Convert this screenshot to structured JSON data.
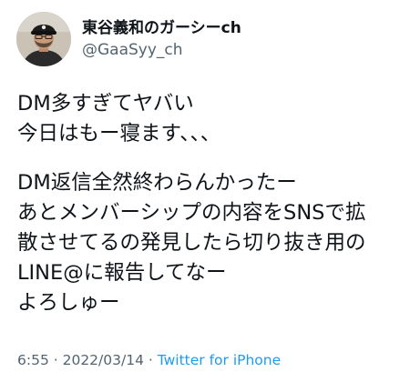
{
  "user": {
    "display_name": "東谷義和のガーシーch",
    "handle": "@GaaSyy_ch"
  },
  "tweet": {
    "paragraph1": [
      "DM多すぎてヤバい",
      "今日はもー寝ます、、、"
    ],
    "paragraph2": [
      "DM返信全然終わらんかったー",
      "あとメンバーシップの内容をSNSで拡",
      "散させてるの発見したら切り抜き用の",
      "LINE@に報告してなー",
      "よろしゅー"
    ]
  },
  "meta": {
    "time": "6:55",
    "separator": " · ",
    "date": "2022/03/14",
    "separator2": " · ",
    "source": "Twitter for iPhone"
  },
  "colors": {
    "text": "#0f1419",
    "secondary": "#536471",
    "link": "#1d9bf0"
  }
}
